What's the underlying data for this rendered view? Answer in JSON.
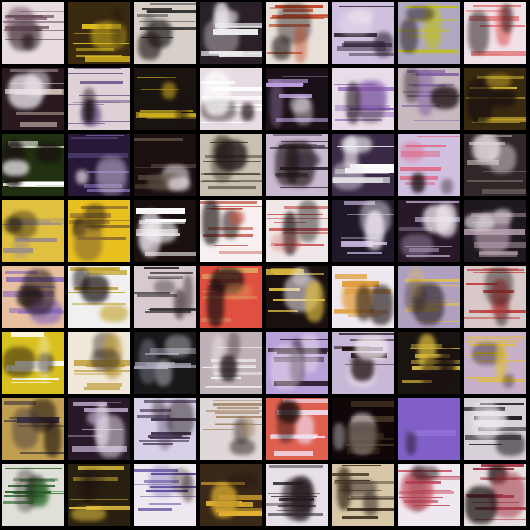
{
  "grid": {
    "rows": 8,
    "cols": 8,
    "background": "#000000",
    "tiles": [
      {
        "bg": "#e8dce0",
        "accent": "#6a4a5a",
        "style": "text"
      },
      {
        "bg": "#3a2a10",
        "accent": "#e0c020",
        "style": "busy"
      },
      {
        "bg": "#d8d0c8",
        "accent": "#2a2a2a",
        "style": "text"
      },
      {
        "bg": "#2a2028",
        "accent": "#f0f0f0",
        "style": "dark"
      },
      {
        "bg": "#e8e0d8",
        "accent": "#c04020",
        "style": "text"
      },
      {
        "bg": "#d0c0e0",
        "accent": "#2a2030",
        "style": "dark"
      },
      {
        "bg": "#b0a8c0",
        "accent": "#c0c020",
        "style": "busy"
      },
      {
        "bg": "#f0e0e8",
        "accent": "#e06060",
        "style": "light"
      },
      {
        "bg": "#2a1a20",
        "accent": "#d8c8c0",
        "style": "dark"
      },
      {
        "bg": "#e0d0d8",
        "accent": "#6a5a8a",
        "style": "text"
      },
      {
        "bg": "#1a1410",
        "accent": "#d0b020",
        "style": "busy"
      },
      {
        "bg": "#e8dce4",
        "accent": "#ffffff",
        "style": "light"
      },
      {
        "bg": "#1a1018",
        "accent": "#c0a0e0",
        "style": "dark"
      },
      {
        "bg": "#e8dce8",
        "accent": "#9060c0",
        "style": "light"
      },
      {
        "bg": "#c8b8c0",
        "accent": "#8060a0",
        "style": "text"
      },
      {
        "bg": "#3a2a10",
        "accent": "#e0c030",
        "style": "busy"
      },
      {
        "bg": "#203010",
        "accent": "#ffffff",
        "style": "busy"
      },
      {
        "bg": "#281838",
        "accent": "#7060a0",
        "style": "dark"
      },
      {
        "bg": "#1a1010",
        "accent": "#5a4a40",
        "style": "dark"
      },
      {
        "bg": "#c8c0b0",
        "accent": "#4a4030",
        "style": "text"
      },
      {
        "bg": "#c8b8d0",
        "accent": "#3a3040",
        "style": "text"
      },
      {
        "bg": "#3a2a48",
        "accent": "#ffffff",
        "style": "dark"
      },
      {
        "bg": "#d0c0e0",
        "accent": "#e06080",
        "style": "busy"
      },
      {
        "bg": "#302828",
        "accent": "#a09090",
        "style": "dark"
      },
      {
        "bg": "#e0c040",
        "accent": "#a09080",
        "style": "busy"
      },
      {
        "bg": "#e8c020",
        "accent": "#8a6a30",
        "style": "busy"
      },
      {
        "bg": "#1a1010",
        "accent": "#ffffff",
        "style": "dark"
      },
      {
        "bg": "#f8f0f0",
        "accent": "#c05040",
        "style": "text"
      },
      {
        "bg": "#f0e8e8",
        "accent": "#d06060",
        "style": "text"
      },
      {
        "bg": "#201828",
        "accent": "#c0b0d8",
        "style": "dark"
      },
      {
        "bg": "#281828",
        "accent": "#a090b0",
        "style": "dark"
      },
      {
        "bg": "#201820",
        "accent": "#c0a8b8",
        "style": "dark"
      },
      {
        "bg": "#e8c0a0",
        "accent": "#8060c0",
        "style": "light"
      },
      {
        "bg": "#f0f0f0",
        "accent": "#c0a020",
        "style": "light"
      },
      {
        "bg": "#d8c8d0",
        "accent": "#303030",
        "style": "text"
      },
      {
        "bg": "#e05040",
        "accent": "#e0a060",
        "style": "busy"
      },
      {
        "bg": "#1a1010",
        "accent": "#e0c040",
        "style": "dark"
      },
      {
        "bg": "#f0e8f0",
        "accent": "#e0a040",
        "style": "light"
      },
      {
        "bg": "#b0a0c0",
        "accent": "#e0c050",
        "style": "busy"
      },
      {
        "bg": "#d8c8c8",
        "accent": "#c04040",
        "style": "text"
      },
      {
        "bg": "#d8c020",
        "accent": "#ffffff",
        "style": "busy"
      },
      {
        "bg": "#f0e8d8",
        "accent": "#c0a040",
        "style": "light"
      },
      {
        "bg": "#18181a",
        "accent": "#a0a0b0",
        "style": "dark"
      },
      {
        "bg": "#c0b0b8",
        "accent": "#f0f0f0",
        "style": "text"
      },
      {
        "bg": "#b8a0d8",
        "accent": "#302030",
        "style": "dark"
      },
      {
        "bg": "#c8b8d8",
        "accent": "#201010",
        "style": "dark"
      },
      {
        "bg": "#1a1410",
        "accent": "#e0c040",
        "style": "busy"
      },
      {
        "bg": "#c8b0c8",
        "accent": "#e0c040",
        "style": "text"
      },
      {
        "bg": "#c0a050",
        "accent": "#3a3040",
        "style": "busy"
      },
      {
        "bg": "#281828",
        "accent": "#c0b0d0",
        "style": "dark"
      },
      {
        "bg": "#d8d0e8",
        "accent": "#403050",
        "style": "text"
      },
      {
        "bg": "#e0d8d8",
        "accent": "#a08060",
        "style": "text"
      },
      {
        "bg": "#e06050",
        "accent": "#f0e0f0",
        "style": "busy"
      },
      {
        "bg": "#100808",
        "accent": "#403020",
        "style": "dark"
      },
      {
        "bg": "#8060c8",
        "accent": "#9070d8",
        "style": "flat"
      },
      {
        "bg": "#d8d0d8",
        "accent": "#202020",
        "style": "dark"
      },
      {
        "bg": "#e0e0d8",
        "accent": "#2a6a2a",
        "style": "text"
      },
      {
        "bg": "#2a2010",
        "accent": "#e0c040",
        "style": "busy"
      },
      {
        "bg": "#f0e8f0",
        "accent": "#6050a0",
        "style": "text"
      },
      {
        "bg": "#3a2818",
        "accent": "#e0b030",
        "style": "busy"
      },
      {
        "bg": "#e8e0e8",
        "accent": "#302830",
        "style": "text"
      },
      {
        "bg": "#d8c8a8",
        "accent": "#403020",
        "style": "text"
      },
      {
        "bg": "#f0e8f0",
        "accent": "#c04050",
        "style": "text"
      },
      {
        "bg": "#e8e0e0",
        "accent": "#a03040",
        "style": "text"
      }
    ]
  }
}
